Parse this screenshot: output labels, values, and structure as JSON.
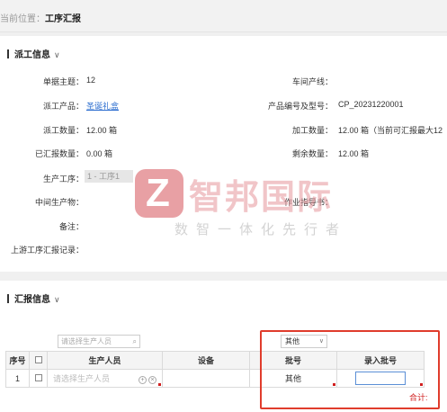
{
  "breadcrumb": {
    "prefix": "当前位置：",
    "current": "工序汇报"
  },
  "dispatch_section": {
    "title": "派工信息",
    "chevron": "∨",
    "fields": {
      "doc_subject_label": "单据主题：",
      "doc_subject_value": "12",
      "workshop_line_label": "车间产线：",
      "workshop_line_value": "",
      "product_label": "派工产品：",
      "product_value": "圣诞礼盒",
      "product_code_label": "产品编号及型号：",
      "product_code_value": "CP_20231220001",
      "dispatch_qty_label": "派工数量：",
      "dispatch_qty_value": "12.00  箱",
      "process_qty_label": "加工数量：",
      "process_qty_value": "12.00  箱（当前可汇报最大12",
      "reported_qty_label": "已汇报数量：",
      "reported_qty_value": "0.00  箱",
      "remaining_qty_label": "剩余数量：",
      "remaining_qty_value": "12.00  箱",
      "process_label": "生产工序：",
      "process_value": "1 - 工序1",
      "intermediate_label": "中间生产物：",
      "intermediate_value": "",
      "work_order_label": "作业指导书：",
      "work_order_value": "",
      "remark_label": "备注：",
      "remark_value": "",
      "upstream_label": "上游工序汇报记录：",
      "upstream_value": ""
    }
  },
  "watermark": {
    "logo_char": "Z",
    "name": "智邦国际",
    "slogan": "数智一体化先行者"
  },
  "report_section": {
    "title": "汇报信息",
    "chevron": "∨",
    "batch_search_placeholder": "请选择生产人员",
    "batch_select_value": "其他",
    "columns": [
      "序号",
      "",
      "生产人员",
      "设备",
      "批号",
      "录入批号"
    ],
    "rows": [
      {
        "index": "1",
        "person_placeholder": "请选择生产人员",
        "device": "",
        "batch": "其他",
        "entered_batch": ""
      }
    ],
    "total_label": "合计:"
  },
  "colors": {
    "accent": "#2a6ccf",
    "highlight": "#e03c2c",
    "required": "#d02020"
  }
}
